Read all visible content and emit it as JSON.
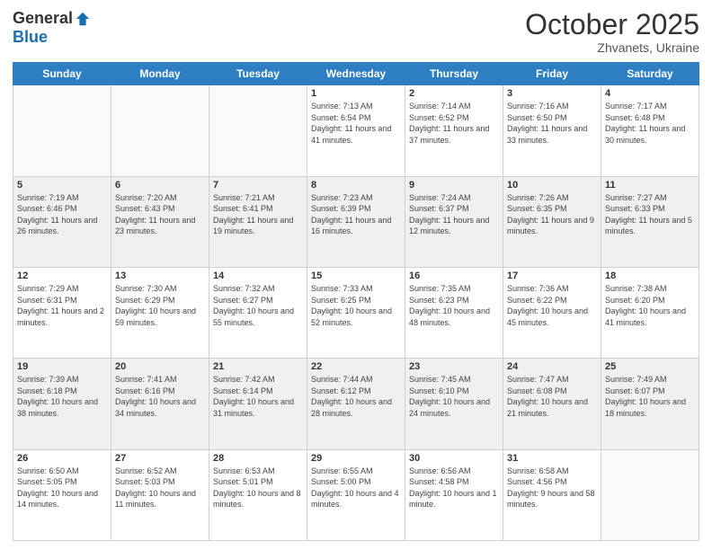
{
  "header": {
    "logo_general": "General",
    "logo_blue": "Blue",
    "month_title": "October 2025",
    "location": "Zhvanets, Ukraine"
  },
  "days_of_week": [
    "Sunday",
    "Monday",
    "Tuesday",
    "Wednesday",
    "Thursday",
    "Friday",
    "Saturday"
  ],
  "weeks": [
    [
      {
        "day": "",
        "info": ""
      },
      {
        "day": "",
        "info": ""
      },
      {
        "day": "",
        "info": ""
      },
      {
        "day": "1",
        "info": "Sunrise: 7:13 AM\nSunset: 6:54 PM\nDaylight: 11 hours and 41 minutes."
      },
      {
        "day": "2",
        "info": "Sunrise: 7:14 AM\nSunset: 6:52 PM\nDaylight: 11 hours and 37 minutes."
      },
      {
        "day": "3",
        "info": "Sunrise: 7:16 AM\nSunset: 6:50 PM\nDaylight: 11 hours and 33 minutes."
      },
      {
        "day": "4",
        "info": "Sunrise: 7:17 AM\nSunset: 6:48 PM\nDaylight: 11 hours and 30 minutes."
      }
    ],
    [
      {
        "day": "5",
        "info": "Sunrise: 7:19 AM\nSunset: 6:46 PM\nDaylight: 11 hours and 26 minutes."
      },
      {
        "day": "6",
        "info": "Sunrise: 7:20 AM\nSunset: 6:43 PM\nDaylight: 11 hours and 23 minutes."
      },
      {
        "day": "7",
        "info": "Sunrise: 7:21 AM\nSunset: 6:41 PM\nDaylight: 11 hours and 19 minutes."
      },
      {
        "day": "8",
        "info": "Sunrise: 7:23 AM\nSunset: 6:39 PM\nDaylight: 11 hours and 16 minutes."
      },
      {
        "day": "9",
        "info": "Sunrise: 7:24 AM\nSunset: 6:37 PM\nDaylight: 11 hours and 12 minutes."
      },
      {
        "day": "10",
        "info": "Sunrise: 7:26 AM\nSunset: 6:35 PM\nDaylight: 11 hours and 9 minutes."
      },
      {
        "day": "11",
        "info": "Sunrise: 7:27 AM\nSunset: 6:33 PM\nDaylight: 11 hours and 5 minutes."
      }
    ],
    [
      {
        "day": "12",
        "info": "Sunrise: 7:29 AM\nSunset: 6:31 PM\nDaylight: 11 hours and 2 minutes."
      },
      {
        "day": "13",
        "info": "Sunrise: 7:30 AM\nSunset: 6:29 PM\nDaylight: 10 hours and 59 minutes."
      },
      {
        "day": "14",
        "info": "Sunrise: 7:32 AM\nSunset: 6:27 PM\nDaylight: 10 hours and 55 minutes."
      },
      {
        "day": "15",
        "info": "Sunrise: 7:33 AM\nSunset: 6:25 PM\nDaylight: 10 hours and 52 minutes."
      },
      {
        "day": "16",
        "info": "Sunrise: 7:35 AM\nSunset: 6:23 PM\nDaylight: 10 hours and 48 minutes."
      },
      {
        "day": "17",
        "info": "Sunrise: 7:36 AM\nSunset: 6:22 PM\nDaylight: 10 hours and 45 minutes."
      },
      {
        "day": "18",
        "info": "Sunrise: 7:38 AM\nSunset: 6:20 PM\nDaylight: 10 hours and 41 minutes."
      }
    ],
    [
      {
        "day": "19",
        "info": "Sunrise: 7:39 AM\nSunset: 6:18 PM\nDaylight: 10 hours and 38 minutes."
      },
      {
        "day": "20",
        "info": "Sunrise: 7:41 AM\nSunset: 6:16 PM\nDaylight: 10 hours and 34 minutes."
      },
      {
        "day": "21",
        "info": "Sunrise: 7:42 AM\nSunset: 6:14 PM\nDaylight: 10 hours and 31 minutes."
      },
      {
        "day": "22",
        "info": "Sunrise: 7:44 AM\nSunset: 6:12 PM\nDaylight: 10 hours and 28 minutes."
      },
      {
        "day": "23",
        "info": "Sunrise: 7:45 AM\nSunset: 6:10 PM\nDaylight: 10 hours and 24 minutes."
      },
      {
        "day": "24",
        "info": "Sunrise: 7:47 AM\nSunset: 6:08 PM\nDaylight: 10 hours and 21 minutes."
      },
      {
        "day": "25",
        "info": "Sunrise: 7:49 AM\nSunset: 6:07 PM\nDaylight: 10 hours and 18 minutes."
      }
    ],
    [
      {
        "day": "26",
        "info": "Sunrise: 6:50 AM\nSunset: 5:05 PM\nDaylight: 10 hours and 14 minutes."
      },
      {
        "day": "27",
        "info": "Sunrise: 6:52 AM\nSunset: 5:03 PM\nDaylight: 10 hours and 11 minutes."
      },
      {
        "day": "28",
        "info": "Sunrise: 6:53 AM\nSunset: 5:01 PM\nDaylight: 10 hours and 8 minutes."
      },
      {
        "day": "29",
        "info": "Sunrise: 6:55 AM\nSunset: 5:00 PM\nDaylight: 10 hours and 4 minutes."
      },
      {
        "day": "30",
        "info": "Sunrise: 6:56 AM\nSunset: 4:58 PM\nDaylight: 10 hours and 1 minute."
      },
      {
        "day": "31",
        "info": "Sunrise: 6:58 AM\nSunset: 4:56 PM\nDaylight: 9 hours and 58 minutes."
      },
      {
        "day": "",
        "info": ""
      }
    ]
  ]
}
